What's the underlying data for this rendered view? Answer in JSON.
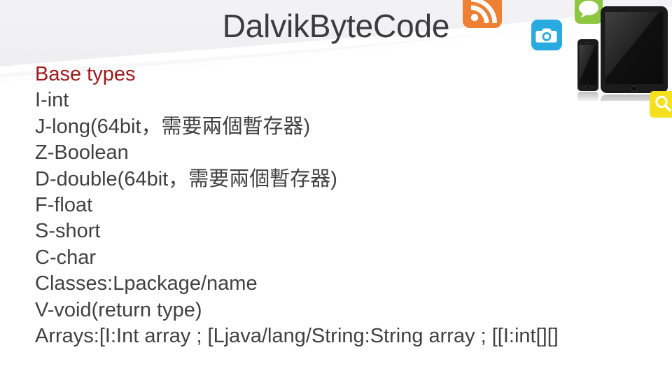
{
  "slide": {
    "title": "DalvikByteCode",
    "title_color": "#3b3b3d",
    "background_color": "#ffffff",
    "banner_color": "#eeeef0"
  },
  "content": {
    "heading": "Base types",
    "heading_color": "#9e1b1b",
    "body_color": "#414141",
    "lines": [
      "I-int",
      "J-long(64bit，需要兩個暫存器)",
      "Z-Boolean",
      "D-double(64bit，需要兩個暫存器)",
      "F-float",
      "S-short",
      "C-char",
      "Classes:Lpackage/name",
      "V-void(return type)",
      "Arrays:[I:Int array ; [Ljava/lang/String:String array ;  [[I:int[][]"
    ]
  },
  "decorations": {
    "icons": [
      {
        "name": "rss-icon",
        "color": "#ef8033"
      },
      {
        "name": "camera-icon",
        "color": "#29abe2"
      },
      {
        "name": "chat-bubble-icon",
        "color": "#8dc63f"
      },
      {
        "name": "search-icon",
        "color": "#f5e01e"
      }
    ],
    "devices": [
      {
        "name": "smartphone-graphic",
        "color": "#1a1a1a"
      },
      {
        "name": "tablet-graphic",
        "color": "#1a1a1a"
      }
    ]
  }
}
